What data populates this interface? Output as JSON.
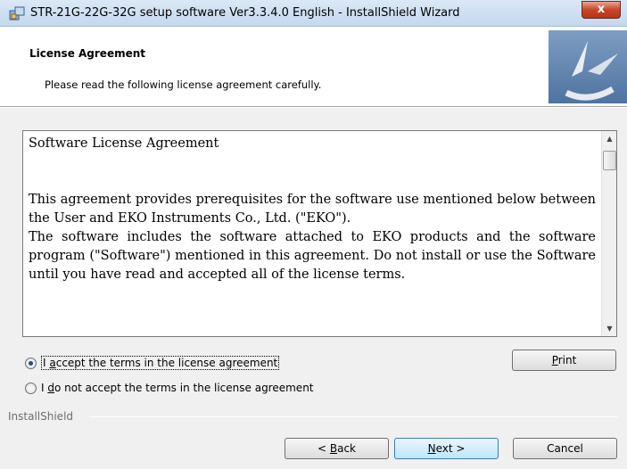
{
  "window": {
    "title": "STR-21G-22G-32G setup software Ver3.3.4.0 English - InstallShield Wizard",
    "close_label": "x"
  },
  "header": {
    "title": "License Agreement",
    "subtitle": "Please read the following license agreement carefully."
  },
  "license": {
    "title": "Software License Agreement",
    "paragraphs": [
      "This agreement provides prerequisites for the software use mentioned below between the User and EKO Instruments Co., Ltd. (\"EKO\").",
      "The software includes the software attached to EKO products and the software program (\"Software\") mentioned in this agreement. Do not install or use the Software until you have read and accepted all of the license terms."
    ]
  },
  "options": {
    "accept_prefix": "I ",
    "accept_key": "a",
    "accept_rest": "ccept the terms in the license agreement",
    "decline_prefix": "I ",
    "decline_key": "d",
    "decline_rest": "o not accept the terms in the license agreement",
    "selected": "accept"
  },
  "buttons": {
    "print_key": "P",
    "print_rest": "rint",
    "back_prefix": "< ",
    "back_key": "B",
    "back_rest": "ack",
    "next_key": "N",
    "next_rest": "ext >",
    "cancel": "Cancel"
  },
  "footer": {
    "brand": "InstallShield"
  },
  "colors": {
    "accent": "#3c7fb1",
    "close_red": "#c7462b"
  }
}
